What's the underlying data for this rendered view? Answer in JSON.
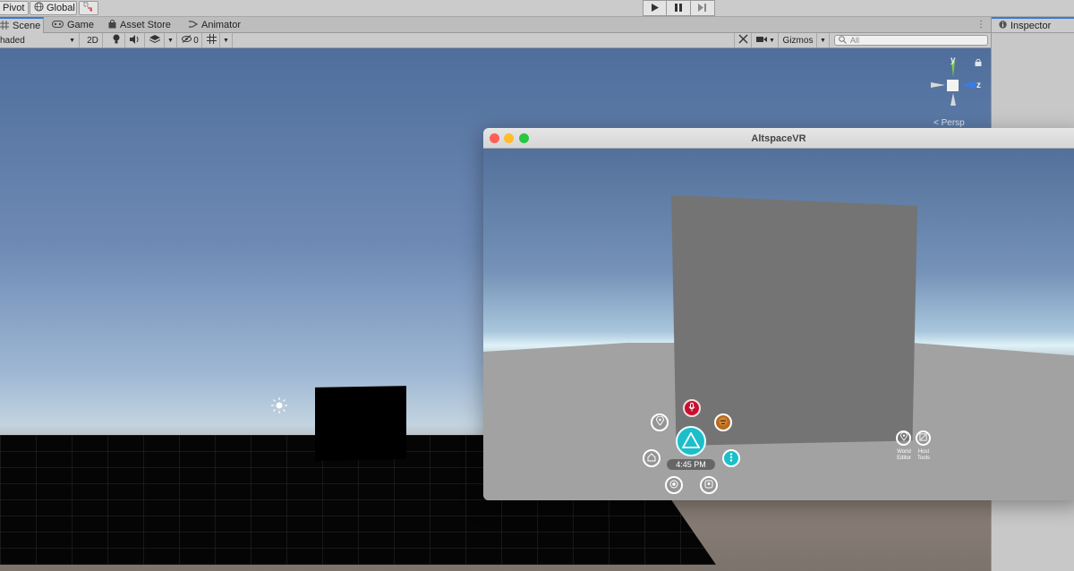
{
  "toolbar": {
    "pivot_label": "Pivot",
    "global_label": "Global",
    "play_icon": "play-icon",
    "pause_icon": "pause-icon",
    "step_icon": "step-icon"
  },
  "tabs": [
    {
      "label": "Scene",
      "icon": "scene-grid-icon"
    },
    {
      "label": "Game",
      "icon": "gamepad-icon"
    },
    {
      "label": "Asset Store",
      "icon": "shopping-bag-icon"
    },
    {
      "label": "Animator",
      "icon": "animator-icon"
    }
  ],
  "scene_toolbar": {
    "shading_mode": "haded",
    "mode_2d": "2D",
    "hidden_count": "0",
    "gizmos_label": "Gizmos",
    "search_placeholder": "All"
  },
  "scene": {
    "axis_y": "y",
    "axis_z": "z",
    "projection_label": "Persp"
  },
  "inspector": {
    "tab_label": "Inspector"
  },
  "altspace": {
    "window_title": "AltspaceVR",
    "time_label": "4:45 PM",
    "world_editor_label": [
      "World",
      "Editor"
    ],
    "host_tools_label": [
      "Host",
      "Tools"
    ],
    "colors": {
      "main_button": "#1cbfc9",
      "mic_button": "#c8102e",
      "close_light": "#ff5f57",
      "minimize_light": "#febc2e",
      "zoom_light": "#28c840"
    }
  }
}
